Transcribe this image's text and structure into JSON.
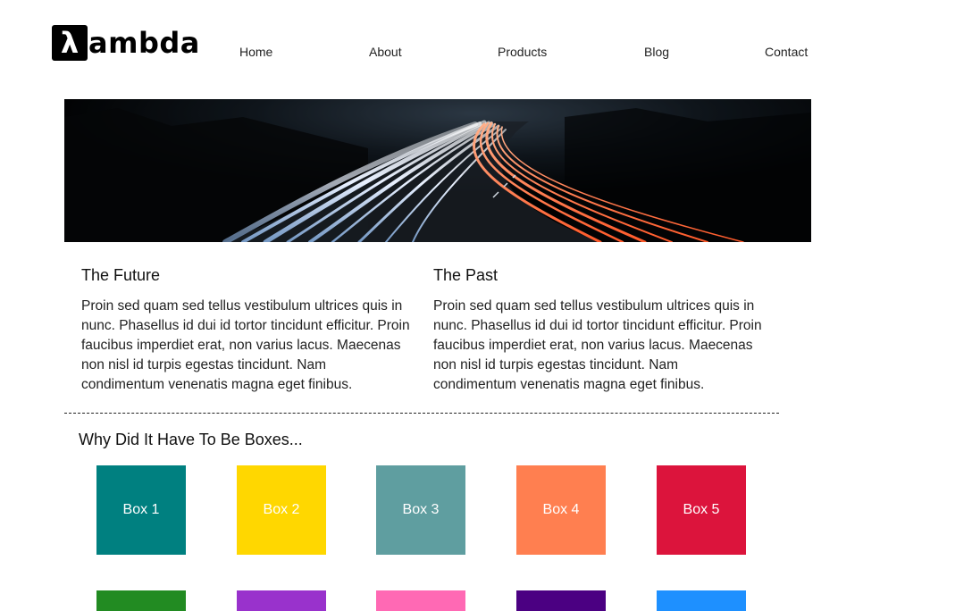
{
  "logo": {
    "mark": "λ",
    "text": "ambda"
  },
  "nav": [
    {
      "label": "Home"
    },
    {
      "label": "About"
    },
    {
      "label": "Products"
    },
    {
      "label": "Blog"
    },
    {
      "label": "Contact"
    }
  ],
  "sections": [
    {
      "title": "The Future",
      "body": "Proin sed quam sed tellus vestibulum ultrices quis in nunc. Phasellus id dui id tortor tincidunt efficitur. Proin faucibus imperdiet erat, non varius lacus. Maecenas non nisl id turpis egestas tincidunt. Nam condimentum venenatis magna eget finibus."
    },
    {
      "title": "The Past",
      "body": "Proin sed quam sed tellus vestibulum ultrices quis in nunc. Phasellus id dui id tortor tincidunt efficitur. Proin faucibus imperdiet erat, non varius lacus. Maecenas non nisl id turpis egestas tincidunt. Nam condimentum venenatis magna eget finibus."
    }
  ],
  "boxes": {
    "title": "Why Did It Have To Be Boxes...",
    "row1": [
      {
        "label": "Box 1",
        "color": "#008080"
      },
      {
        "label": "Box 2",
        "color": "#FFD700"
      },
      {
        "label": "Box 3",
        "color": "#5F9EA0"
      },
      {
        "label": "Box 4",
        "color": "#FF7F50"
      },
      {
        "label": "Box 5",
        "color": "#DC143C"
      }
    ],
    "row2": [
      {
        "color": "#228B22"
      },
      {
        "color": "#9932CC"
      },
      {
        "color": "#FF69B4"
      },
      {
        "color": "#4B0082"
      },
      {
        "color": "#1E90FF"
      }
    ]
  }
}
